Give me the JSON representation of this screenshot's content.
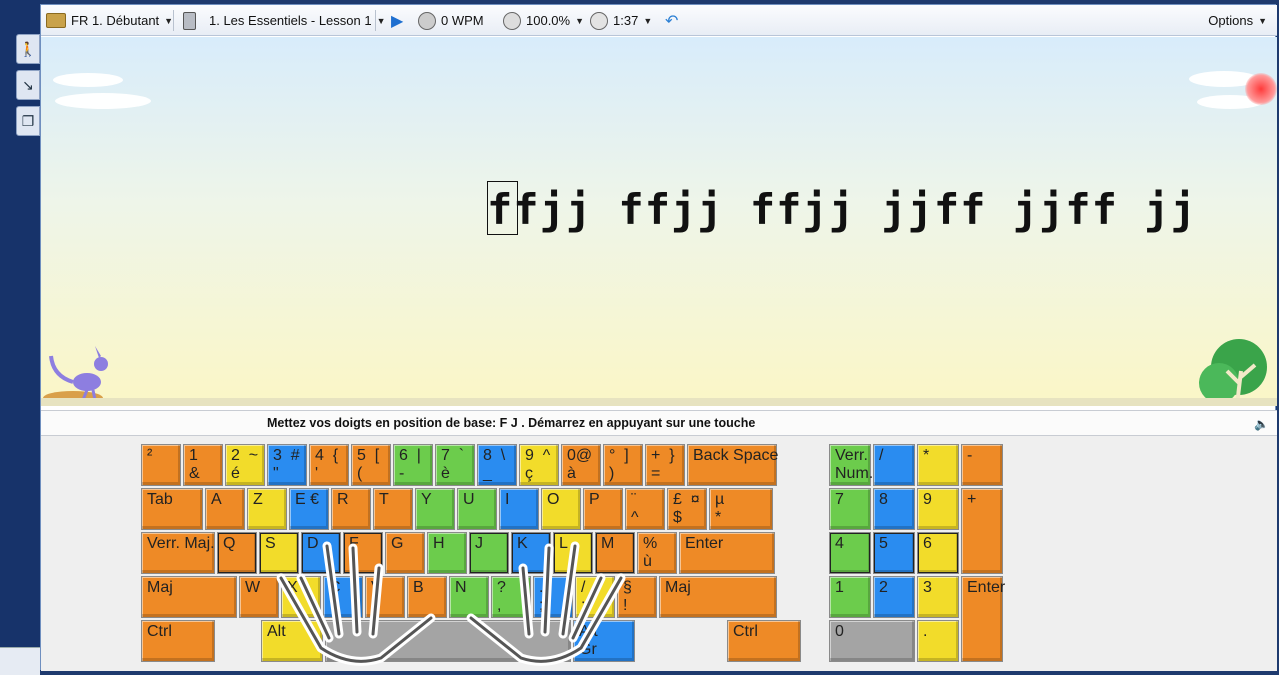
{
  "toolbar": {
    "course": "FR 1. Débutant",
    "lesson": "1. Les Essentiels - Lesson 1",
    "speed": "0 WPM",
    "accuracy": "100.0%",
    "time": "1:37",
    "options": "Options"
  },
  "drill": {
    "text": "ffjj ffjj ffjj jjff jjff jj",
    "current_char": "f"
  },
  "status": {
    "message": "Mettez vos doigts en position de base:  F  J .  Démarrez en appuyant sur une touche"
  },
  "keyboard": {
    "rows": [
      [
        {
          "label": "²",
          "color": "orange",
          "w": 42
        },
        {
          "label": "1\n&",
          "color": "orange",
          "w": 42
        },
        {
          "label": "2  ~\né",
          "color": "yellow",
          "w": 42
        },
        {
          "label": "3  #\n\"",
          "color": "blue",
          "w": 42
        },
        {
          "label": "4  {\n'",
          "color": "orange",
          "w": 42
        },
        {
          "label": "5  [\n(",
          "color": "orange",
          "w": 42
        },
        {
          "label": "6  |\n-",
          "color": "green",
          "w": 42
        },
        {
          "label": "7  `\nè",
          "color": "green",
          "w": 42
        },
        {
          "label": "8  \\\n_",
          "color": "blue",
          "w": 42
        },
        {
          "label": "9  ^\nç",
          "color": "yellow",
          "w": 42
        },
        {
          "label": "0@\nà",
          "color": "orange",
          "w": 42
        },
        {
          "label": "°  ]\n)",
          "color": "orange",
          "w": 42
        },
        {
          "label": "+  }\n=",
          "color": "orange",
          "w": 42
        },
        {
          "label": "Back Space",
          "color": "orange",
          "w": 92
        }
      ],
      [
        {
          "label": "Tab",
          "color": "orange",
          "w": 64
        },
        {
          "label": "A",
          "color": "orange",
          "w": 42
        },
        {
          "label": "Z",
          "color": "yellow",
          "w": 42
        },
        {
          "label": "E €",
          "color": "blue",
          "w": 42
        },
        {
          "label": "R",
          "color": "orange",
          "w": 42
        },
        {
          "label": "T",
          "color": "orange",
          "w": 42
        },
        {
          "label": "Y",
          "color": "green",
          "w": 42
        },
        {
          "label": "U",
          "color": "green",
          "w": 42
        },
        {
          "label": "I",
          "color": "blue",
          "w": 42
        },
        {
          "label": "O",
          "color": "yellow",
          "w": 42
        },
        {
          "label": "P",
          "color": "orange",
          "w": 42
        },
        {
          "label": "¨\n^",
          "color": "orange",
          "w": 42
        },
        {
          "label": "£  ¤\n$",
          "color": "orange",
          "w": 42
        },
        {
          "label": "µ\n*",
          "color": "orange",
          "w": 66
        }
      ],
      [
        {
          "label": "Verr. Maj.",
          "color": "orange",
          "w": 76
        },
        {
          "label": "Q",
          "color": "orange",
          "w": 42,
          "home": true
        },
        {
          "label": "S",
          "color": "yellow",
          "w": 42,
          "home": true
        },
        {
          "label": "D",
          "color": "blue",
          "w": 42,
          "home": true
        },
        {
          "label": "F",
          "color": "orange",
          "w": 42,
          "home": true
        },
        {
          "label": "G",
          "color": "orange",
          "w": 42
        },
        {
          "label": "H",
          "color": "green",
          "w": 42
        },
        {
          "label": "J",
          "color": "green",
          "w": 42,
          "home": true
        },
        {
          "label": "K",
          "color": "blue",
          "w": 42,
          "home": true
        },
        {
          "label": "L",
          "color": "yellow",
          "w": 42,
          "home": true
        },
        {
          "label": "M",
          "color": "orange",
          "w": 42,
          "home": true
        },
        {
          "label": "%\nù",
          "color": "orange",
          "w": 42
        },
        {
          "label": "Enter",
          "color": "orange",
          "w": 98
        }
      ],
      [
        {
          "label": "Maj",
          "color": "orange",
          "w": 98
        },
        {
          "label": "W",
          "color": "orange",
          "w": 42
        },
        {
          "label": "X",
          "color": "yellow",
          "w": 42
        },
        {
          "label": "C",
          "color": "blue",
          "w": 42
        },
        {
          "label": "V",
          "color": "orange",
          "w": 42
        },
        {
          "label": "B",
          "color": "orange",
          "w": 42
        },
        {
          "label": "N",
          "color": "green",
          "w": 42
        },
        {
          "label": "?\n,",
          "color": "green",
          "w": 42
        },
        {
          "label": ".\n;",
          "color": "blue",
          "w": 42
        },
        {
          "label": "/\n:",
          "color": "yellow",
          "w": 42
        },
        {
          "label": "§\n!",
          "color": "orange",
          "w": 42
        },
        {
          "label": "Maj",
          "color": "orange",
          "w": 120
        }
      ],
      [
        {
          "label": "Ctrl",
          "color": "orange",
          "w": 76
        },
        {
          "label": "Alt",
          "color": "yellow",
          "w": 64
        },
        {
          "label": "",
          "color": "gray",
          "w": 248
        },
        {
          "label": "Alt\nGr",
          "color": "blue",
          "w": 64
        },
        {
          "label": "Ctrl",
          "color": "orange",
          "w": 76
        }
      ]
    ],
    "numpad": [
      {
        "label": "Verr.\nNum.",
        "color": "green"
      },
      {
        "label": "/",
        "color": "blue"
      },
      {
        "label": "*",
        "color": "yellow"
      },
      {
        "label": "-",
        "color": "orange"
      },
      {
        "label": "7",
        "color": "green"
      },
      {
        "label": "8",
        "color": "blue"
      },
      {
        "label": "9",
        "color": "yellow"
      },
      {
        "label": "+",
        "color": "orange"
      },
      {
        "label": "4",
        "color": "green"
      },
      {
        "label": "5",
        "color": "blue"
      },
      {
        "label": "6",
        "color": "yellow"
      },
      {
        "label": "1",
        "color": "green"
      },
      {
        "label": "2",
        "color": "blue"
      },
      {
        "label": "3",
        "color": "yellow"
      },
      {
        "label": "Enter",
        "color": "orange"
      },
      {
        "label": "0",
        "color": "gray"
      },
      {
        "label": ".",
        "color": "yellow"
      }
    ]
  },
  "colors": {
    "orange": "#ee8a26",
    "yellow": "#f2dc2a",
    "blue": "#2a8cf0",
    "green": "#6ccc4c",
    "gray": "#a4a4a4"
  }
}
